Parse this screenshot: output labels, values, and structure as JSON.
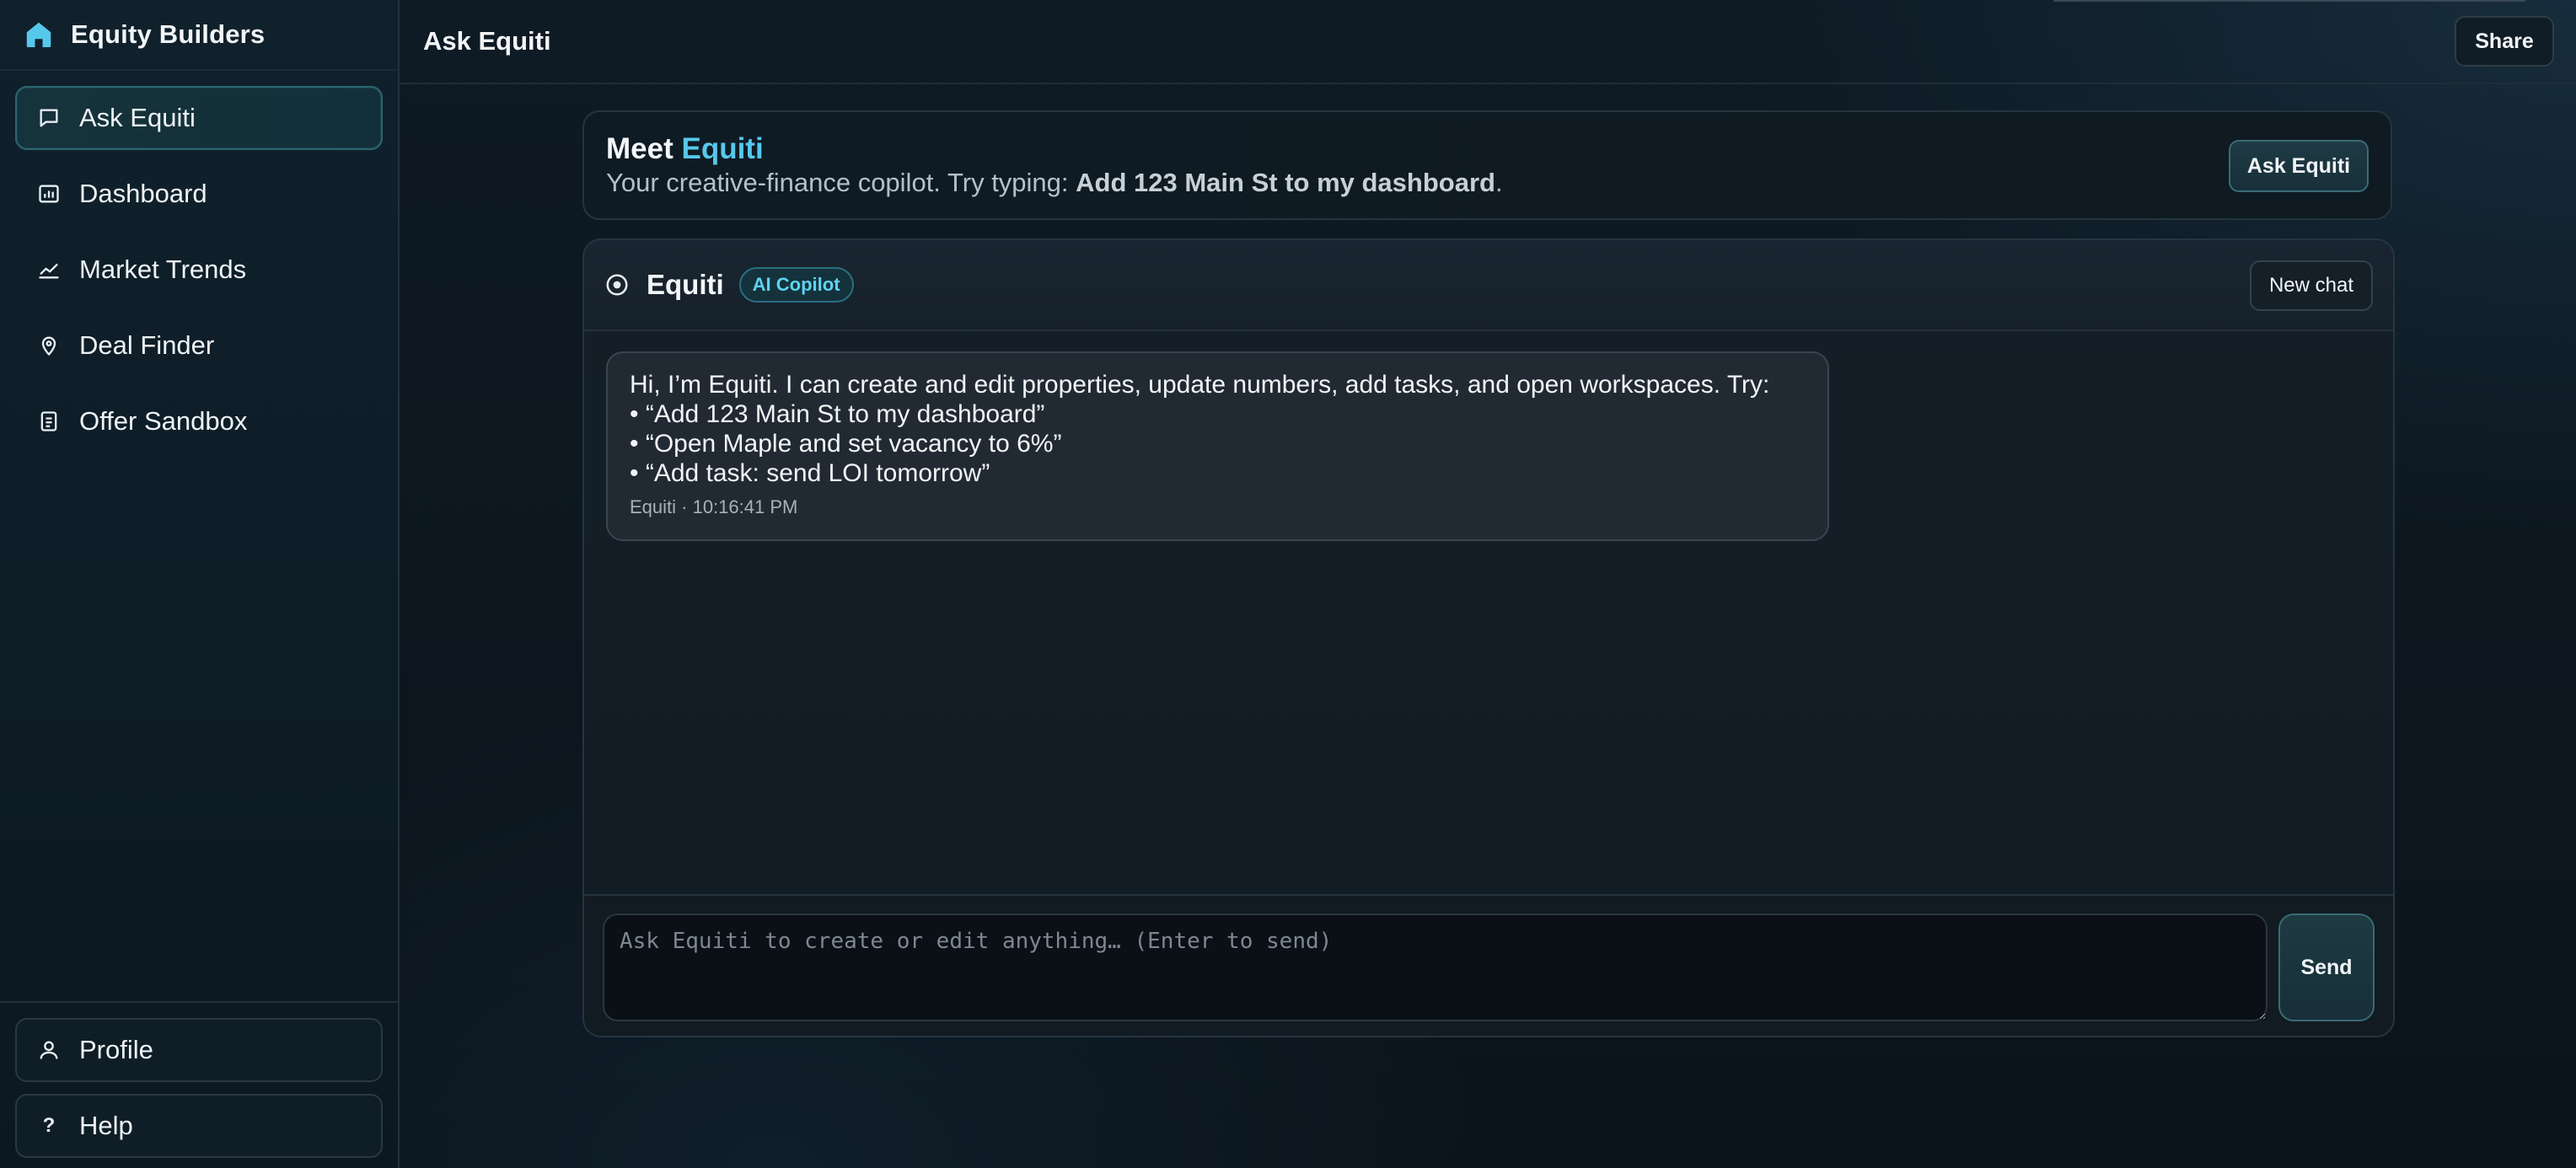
{
  "brand": {
    "name": "Equity Builders",
    "icon": "home-icon",
    "accent": "#56c8ec"
  },
  "sidebar": {
    "items": [
      {
        "label": "Ask Equiti",
        "icon": "chat-bubble-icon",
        "active": true
      },
      {
        "label": "Dashboard",
        "icon": "bar-chart-icon"
      },
      {
        "label": "Market Trends",
        "icon": "trend-line-icon"
      },
      {
        "label": "Deal Finder",
        "icon": "map-pin-icon"
      },
      {
        "label": "Offer Sandbox",
        "icon": "document-icon"
      }
    ],
    "footer": [
      {
        "label": "Profile",
        "icon": "user-icon"
      },
      {
        "label": "Help",
        "icon": "question-icon"
      }
    ]
  },
  "header": {
    "title": "Ask Equiti",
    "share_label": "Share"
  },
  "meet": {
    "title_prefix": "Meet",
    "title_accent": "Equiti",
    "subtitle_prefix": "Your creative-finance copilot. Try typing:",
    "subtitle_example": "Add 123 Main St to my dashboard",
    "subtitle_suffix": ".",
    "button_label": "Ask Equiti"
  },
  "chat": {
    "name": "Equiti",
    "badge": "AI Copilot",
    "new_chat_label": "New chat",
    "messages": [
      {
        "lines": [
          "Hi, I’m Equiti. I can create and edit properties, update numbers, add tasks, and open workspaces. Try:",
          "• “Add 123 Main St to my dashboard”",
          "• “Open Maple and set vacancy to 6%”",
          "• “Add task: send LOI tomorrow”"
        ],
        "meta": "Equiti · 10:16:41 PM"
      }
    ],
    "composer": {
      "placeholder": "Ask Equiti to create or edit anything… (Enter to send)",
      "value": "",
      "send_label": "Send"
    }
  }
}
